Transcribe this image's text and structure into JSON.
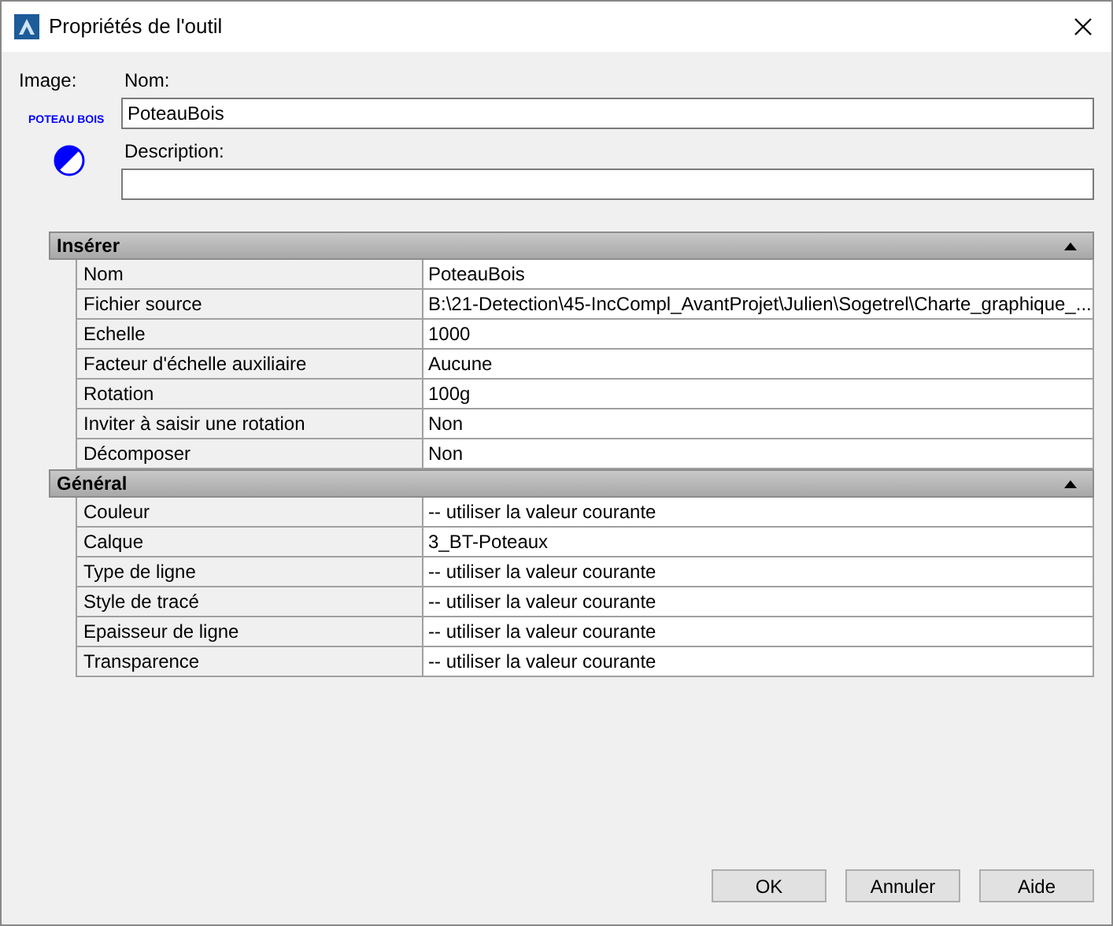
{
  "window": {
    "title": "Propriétés de l'outil"
  },
  "image": {
    "label": "Image:",
    "caption": "POTEAU BOIS"
  },
  "name_field": {
    "label": "Nom:",
    "value": "PoteauBois"
  },
  "description_field": {
    "label": "Description:"
  },
  "sections": [
    {
      "title": "Insérer",
      "expanded": true,
      "rows": [
        {
          "label": "Nom",
          "value": "PoteauBois"
        },
        {
          "label": "Fichier source",
          "value": "B:\\21-Detection\\45-IncCompl_AvantProjet\\Julien\\Sogetrel\\Charte_graphique_..."
        },
        {
          "label": "Echelle",
          "value": "1000"
        },
        {
          "label": "Facteur d'échelle auxiliaire",
          "value": "Aucune"
        },
        {
          "label": "Rotation",
          "value": "100g"
        },
        {
          "label": "Inviter à saisir une rotation",
          "value": "Non"
        },
        {
          "label": "Décomposer",
          "value": "Non"
        }
      ]
    },
    {
      "title": "Général",
      "expanded": true,
      "rows": [
        {
          "label": "Couleur",
          "value": "-- utiliser la valeur courante"
        },
        {
          "label": "Calque",
          "value": "3_BT-Poteaux"
        },
        {
          "label": "Type de ligne",
          "value": "-- utiliser la valeur courante"
        },
        {
          "label": "Style de tracé",
          "value": "-- utiliser la valeur courante"
        },
        {
          "label": "Epaisseur de ligne",
          "value": "-- utiliser la valeur courante"
        },
        {
          "label": "Transparence",
          "value": "-- utiliser la valeur courante"
        }
      ]
    }
  ],
  "buttons": [
    "OK",
    "Annuler",
    "Aide"
  ]
}
